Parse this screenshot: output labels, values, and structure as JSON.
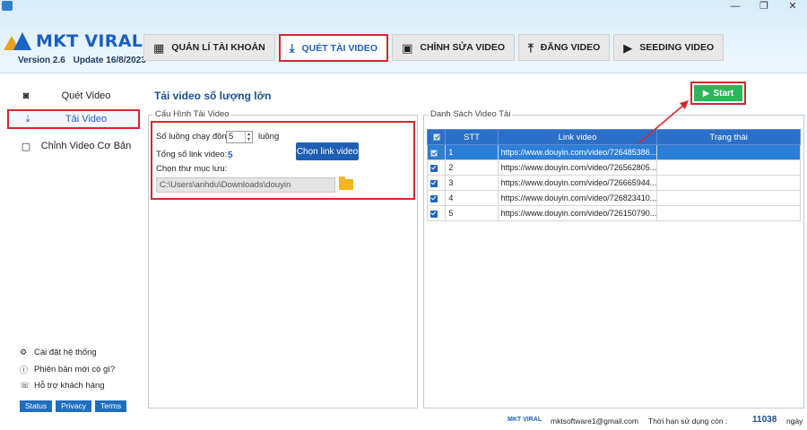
{
  "app": {
    "logo_text": "MKT VIRAL",
    "version": "Version  2.6",
    "update": "Update 16/8/2023",
    "window_controls": [
      "—",
      "❐",
      "✕"
    ]
  },
  "tabs": [
    {
      "label": "QUẢN LÍ TÀI KHOẢN",
      "icon": "grid-icon",
      "active": false
    },
    {
      "label": "QUÉT TÀI VIDEO",
      "icon": "download-icon",
      "active": true
    },
    {
      "label": "CHỈNH SỬA VIDEO",
      "icon": "film-icon",
      "active": false
    },
    {
      "label": "ĐĂNG VIDEO",
      "icon": "upload-icon",
      "active": false
    },
    {
      "label": "SEEDING VIDEO",
      "icon": "video-icon",
      "active": false
    }
  ],
  "sidebar": {
    "items": [
      {
        "label": "Quét Video",
        "icon": "camera-icon",
        "active": false
      },
      {
        "label": "Tải Video",
        "icon": "download-icon",
        "active": true
      },
      {
        "label": "Chỉnh Video Cơ Bản",
        "icon": "chat-icon",
        "active": false
      }
    ],
    "bottom": [
      {
        "label": "Cài đặt hệ thống",
        "icon": "gear-icon"
      },
      {
        "label": "Phiên bản mới có gì?",
        "icon": "info-icon"
      },
      {
        "label": "Hỗ trợ khách hàng",
        "icon": "support-icon"
      }
    ],
    "footer_buttons": [
      "Status",
      "Privacy",
      "Terms"
    ]
  },
  "main": {
    "title": "Tải video số lượng lớn",
    "start_label": "Start",
    "config": {
      "legend": "Cấu Hình Tải Video",
      "threads_label": "Số luồng chạy đồng t",
      "threads_value": "5",
      "threads_unit": "luồng",
      "total_label": "Tổng số link video:",
      "total_value": "5",
      "pick_button": "Chọn link video",
      "folder_label": "Chọn thư mục lưu:",
      "folder_path": "C:\\Users\\anhdu\\Downloads\\douyin"
    },
    "list": {
      "legend": "Danh Sách Video Tải",
      "columns": [
        "STT",
        "Link video",
        "Trạng thái"
      ],
      "rows": [
        {
          "stt": "1",
          "link": "https://www.douyin.com/video/726485386...",
          "status": ""
        },
        {
          "stt": "2",
          "link": "https://www.douyin.com/video/726562805...",
          "status": ""
        },
        {
          "stt": "3",
          "link": "https://www.douyin.com/video/726665944...",
          "status": ""
        },
        {
          "stt": "4",
          "link": "https://www.douyin.com/video/726823410...",
          "status": ""
        },
        {
          "stt": "5",
          "link": "https://www.douyin.com/video/726150790...",
          "status": ""
        }
      ]
    }
  },
  "statusbar": {
    "logo": "MKT VIRAL",
    "email": "mktsoftware1@gmail.com",
    "expiry_label": "Thời hạn sử dụng còn :",
    "days": "11038",
    "days_unit": "ngày"
  },
  "colors": {
    "accent": "#1b5fc2",
    "highlight": "#d7262e",
    "start": "#2fb45a",
    "table_header": "#2b70c8"
  }
}
